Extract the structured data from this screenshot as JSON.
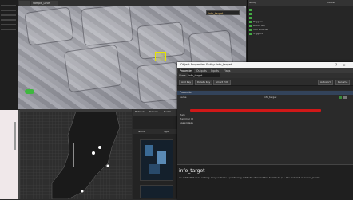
{
  "viewport": {
    "tabs": [
      "",
      "Sample_Level"
    ],
    "combo_value": "info_target"
  },
  "outliner": {
    "title": "",
    "columns": [
      "Group",
      "Model"
    ],
    "rows": [
      "",
      "",
      "",
      "Triggers",
      "Brush Sky",
      "Tool Brushes",
      "Triggers"
    ]
  },
  "tilemap": {
    "header": ""
  },
  "browser": {
    "tabs": [
      "Materials",
      "Textures",
      "Models"
    ],
    "name_label": "Name",
    "type_label": "Type"
  },
  "dialog": {
    "title": "Object Properties Entity: info_target",
    "tabs": [
      "Properties",
      "Outputs",
      "Inputs",
      "Flags"
    ],
    "class_label": "Class:",
    "class_value": "info_target",
    "toolbar": {
      "add_key": "Add Key",
      "delete_key": "Delete Key",
      "smart_edit": "Smart Edit",
      "autosort": "Autosort",
      "rename": "Rename"
    },
    "section": "Properties",
    "props": [
      {
        "key": "name",
        "value": "info_target"
      },
      {
        "key": "",
        "value": ""
      },
      {
        "key": "Help",
        "value": ""
      },
      {
        "key": "Hammer ID",
        "value": ""
      },
      {
        "key": "spawnflags",
        "value": ""
      }
    ],
    "info_title": "info_target",
    "info_text": "An entity that does nothing. Very useful as a positioning entity for other entities to refer to (i.e. the endpoint of an env_beam)"
  }
}
